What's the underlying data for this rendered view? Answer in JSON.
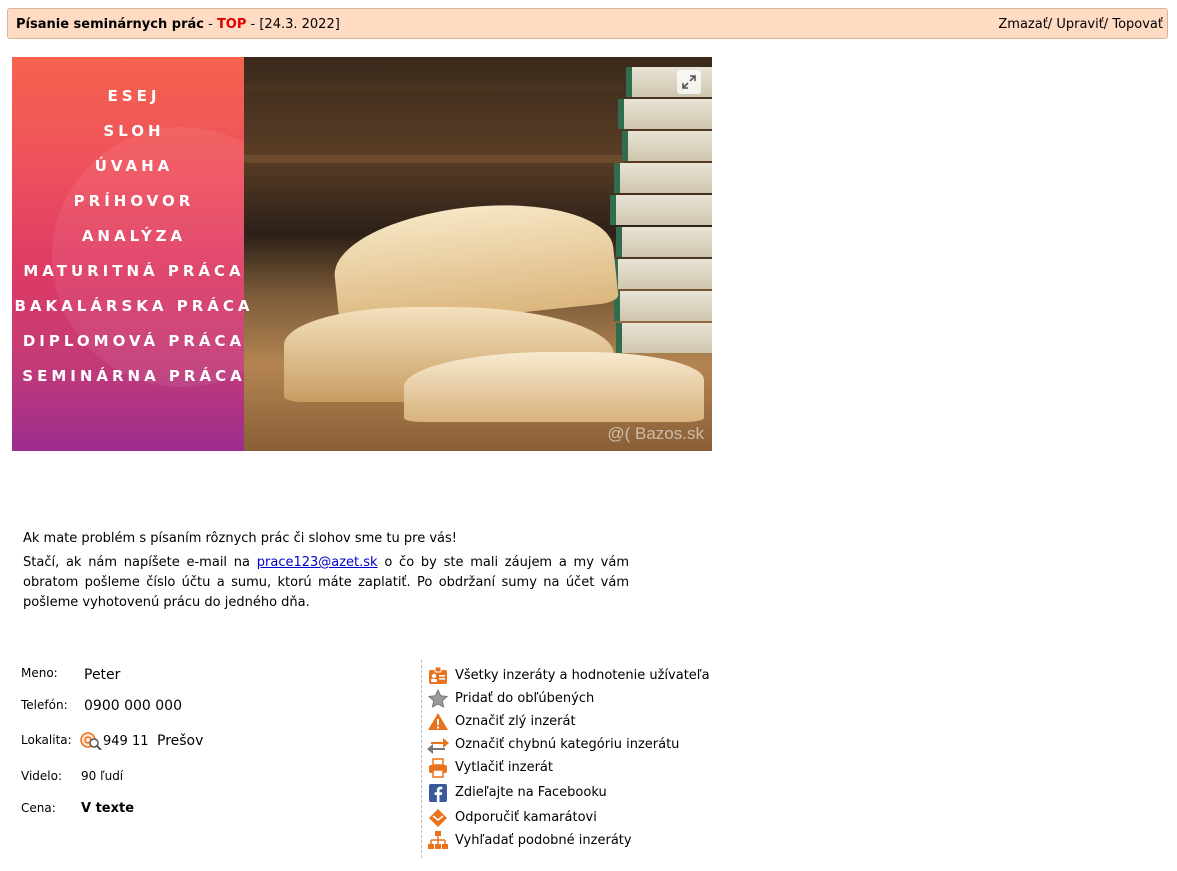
{
  "header": {
    "title": "Písanie seminárnych prác",
    "sep1": " - ",
    "top_label": "TOP",
    "sep2": " - ",
    "date": "[24.3. 2022]",
    "actions": [
      "Zmazať/",
      "Upraviť/",
      "Topovať"
    ]
  },
  "image": {
    "list_items": [
      "ESEJ",
      "SLOH",
      "ÚVAHA",
      "PRÍHOVOR",
      "ANALÝZA",
      "MATURITNÁ PRÁCA",
      "BAKALÁRSKA PRÁCA",
      "DIPLOMOVÁ PRÁCA",
      "SEMINÁRNA PRÁCA"
    ],
    "watermark": "@( Bazos.sk"
  },
  "description": {
    "line1": "Ak mate problém s písaním rôznych prác či slohov sme tu pre vás!",
    "p2_before": "Stačí, ak nám napíšete e-mail na ",
    "email": "prace123@azet.sk",
    "p2_after": " o čo by ste mali záujem a my vám obratom pošleme číslo účtu a sumu, ktorú máte zaplatiť. Po obdržaní sumy na účet vám pošleme vyhotovenú prácu do jedného dňa."
  },
  "details": {
    "name_label": "Meno:",
    "name_value": "Peter",
    "phone_label": "Telefón:",
    "phone_value": "0900 000 000",
    "location_label": "Lokalita:",
    "zip": "949 11",
    "city": "Prešov",
    "views_label": "Videlo:",
    "views_value": "90 ľudí",
    "price_label": "Cena:",
    "price_value": "V texte"
  },
  "links": [
    {
      "icon": "user-card-icon",
      "label": "Všetky inzeráty a hodnotenie užívateľa"
    },
    {
      "icon": "star-icon",
      "label": "Pridať do obľúbených"
    },
    {
      "icon": "warning-icon",
      "label": "Označiť zlý inzerát"
    },
    {
      "icon": "swap-arrows-icon",
      "label": "Označiť chybnú kategóriu inzerátu"
    },
    {
      "icon": "printer-icon",
      "label": "Vytlačiť inzerát"
    },
    {
      "icon": "facebook-icon",
      "label": "Zdieľajte na Facebooku"
    },
    {
      "icon": "send-envelope-icon",
      "label": "Odporučiť kamarátovi"
    },
    {
      "icon": "sitemap-icon",
      "label": "Vyhľadať podobné inzeráty"
    }
  ],
  "colors": {
    "header_bg": "#ffdbc4",
    "top_red": "#e00000",
    "link_blue": "#0000cc",
    "icon_orange": "#e8731c"
  }
}
